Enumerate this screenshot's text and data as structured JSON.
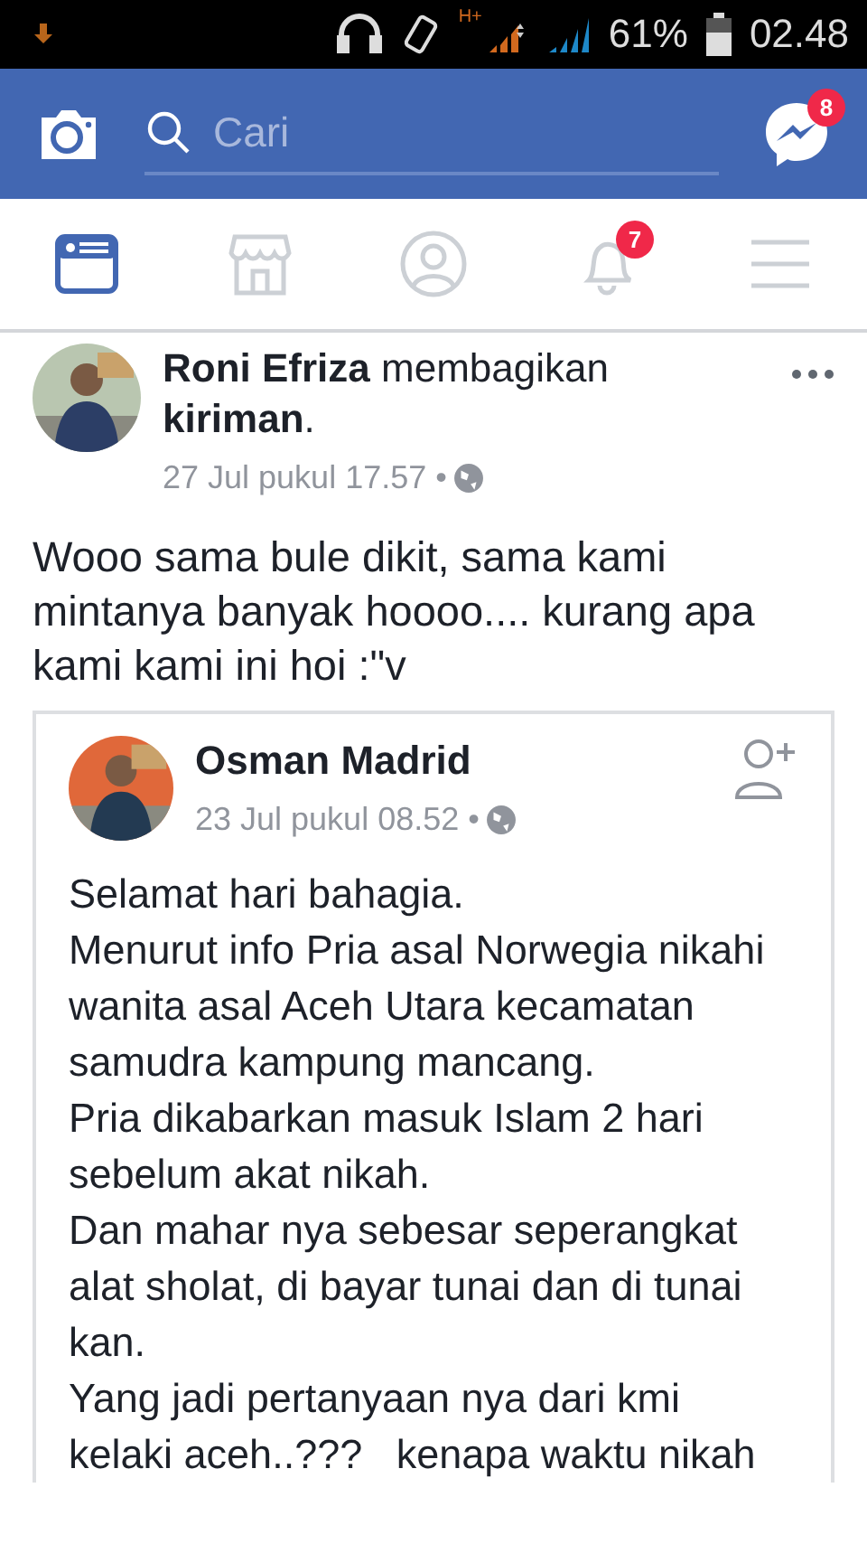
{
  "status_bar": {
    "network": "H+",
    "battery": "61%",
    "time": "02.48"
  },
  "header": {
    "search": {
      "placeholder": "Cari"
    },
    "messenger_badge": "8"
  },
  "nav_tabs": [
    {
      "kind": "feed",
      "selected": true
    },
    {
      "kind": "market",
      "selected": false
    },
    {
      "kind": "profile",
      "selected": false
    },
    {
      "kind": "notifications",
      "selected": false,
      "badge": "7"
    },
    {
      "kind": "menu",
      "selected": false
    }
  ],
  "post": {
    "author": "Roni Efriza",
    "action": "membagikan **kiriman**.",
    "time": "27 Jul pukul 17.57 •",
    "text": "Wooo sama bule dikit, sama kami mintanya banyak hoooo.... kurang apa kami kami ini hoi :\"v",
    "shared": {
      "author": "Osman Madrid",
      "time": "23 Jul pukul 08.52 •",
      "paragraphs": [
        "Selamat hari bahagia.",
        "Menurut info Pria asal Norwegia nikahi wanita asal Aceh Utara kecamatan samudra kampung mancang.",
        "Pria dikabarkan masuk Islam 2 hari sebelum akat nikah.",
        "Dan mahar nya sebesar seperangkat alat sholat, di bayar tunai dan di tunai kan.",
        "Yang jadi pertanyaan nya dari kmi kelaki aceh..???   kenapa waktu nikah"
      ]
    }
  }
}
